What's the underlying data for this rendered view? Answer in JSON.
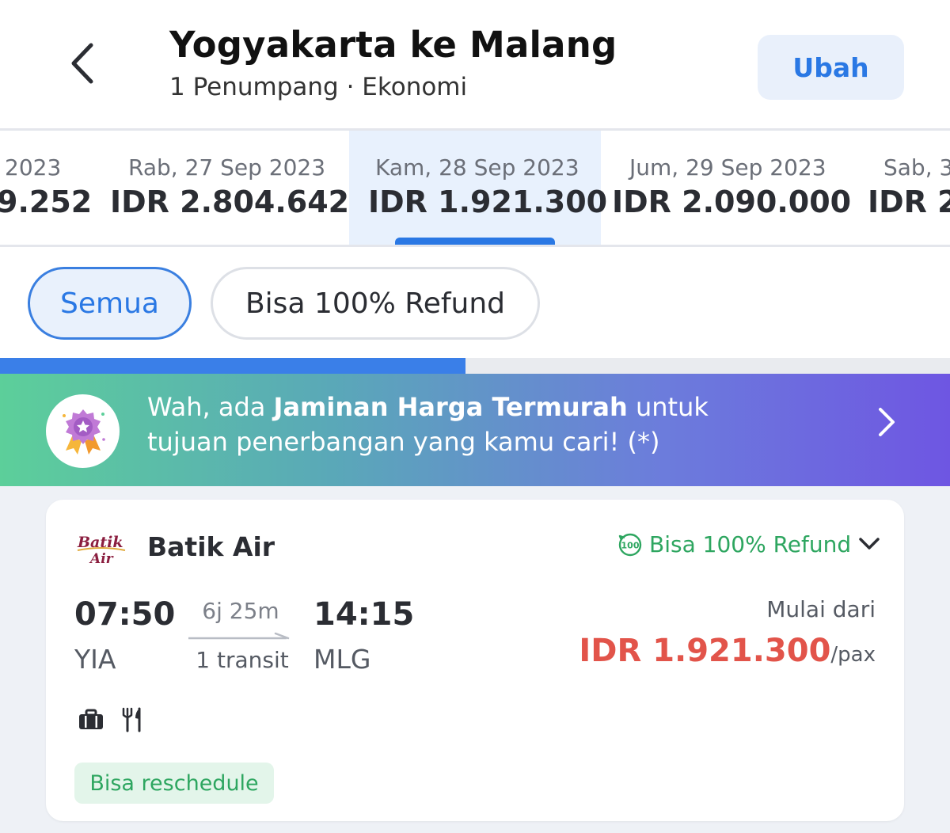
{
  "header": {
    "title": "Yogyakarta ke Malang",
    "subtitle": "1 Penumpang · Ekonomi",
    "change_label": "Ubah"
  },
  "dates": [
    {
      "date": "2023",
      "price": "9.252"
    },
    {
      "date": "Rab, 27 Sep 2023",
      "price": "IDR 2.804.642"
    },
    {
      "date": "Kam, 28 Sep 2023",
      "price": "IDR 1.921.300",
      "selected": true
    },
    {
      "date": "Jum, 29 Sep 2023",
      "price": "IDR 2.090.000"
    },
    {
      "date": "Sab, 3",
      "price": "IDR 2"
    }
  ],
  "filters": {
    "all_label": "Semua",
    "refund_label": "Bisa 100% Refund"
  },
  "progress": {
    "fraction": 0.49
  },
  "banner": {
    "text_before": "Wah, ada ",
    "text_bold": "Jaminan Harga Termurah",
    "text_after": " untuk tujuan penerbangan yang kamu cari! (*)"
  },
  "flight": {
    "airline": "Batik Air",
    "logo_text": "Batik Air",
    "refund_tag": "Bisa 100% Refund",
    "refund_icon_text": "100",
    "departure_time": "07:50",
    "departure_code": "YIA",
    "duration": "6j 25m",
    "transit": "1 transit",
    "arrival_time": "14:15",
    "arrival_code": "MLG",
    "price_label": "Mulai dari",
    "price": "IDR 1.921.300",
    "price_unit": "/pax",
    "reschedule_label": "Bisa reschedule",
    "amenities": [
      "baggage-icon",
      "meal-icon"
    ]
  },
  "colors": {
    "primary": "#2a78e4",
    "price": "#e2544a",
    "success": "#2ea660",
    "banner_start": "#5ccf9a",
    "banner_end": "#6e56e2"
  }
}
